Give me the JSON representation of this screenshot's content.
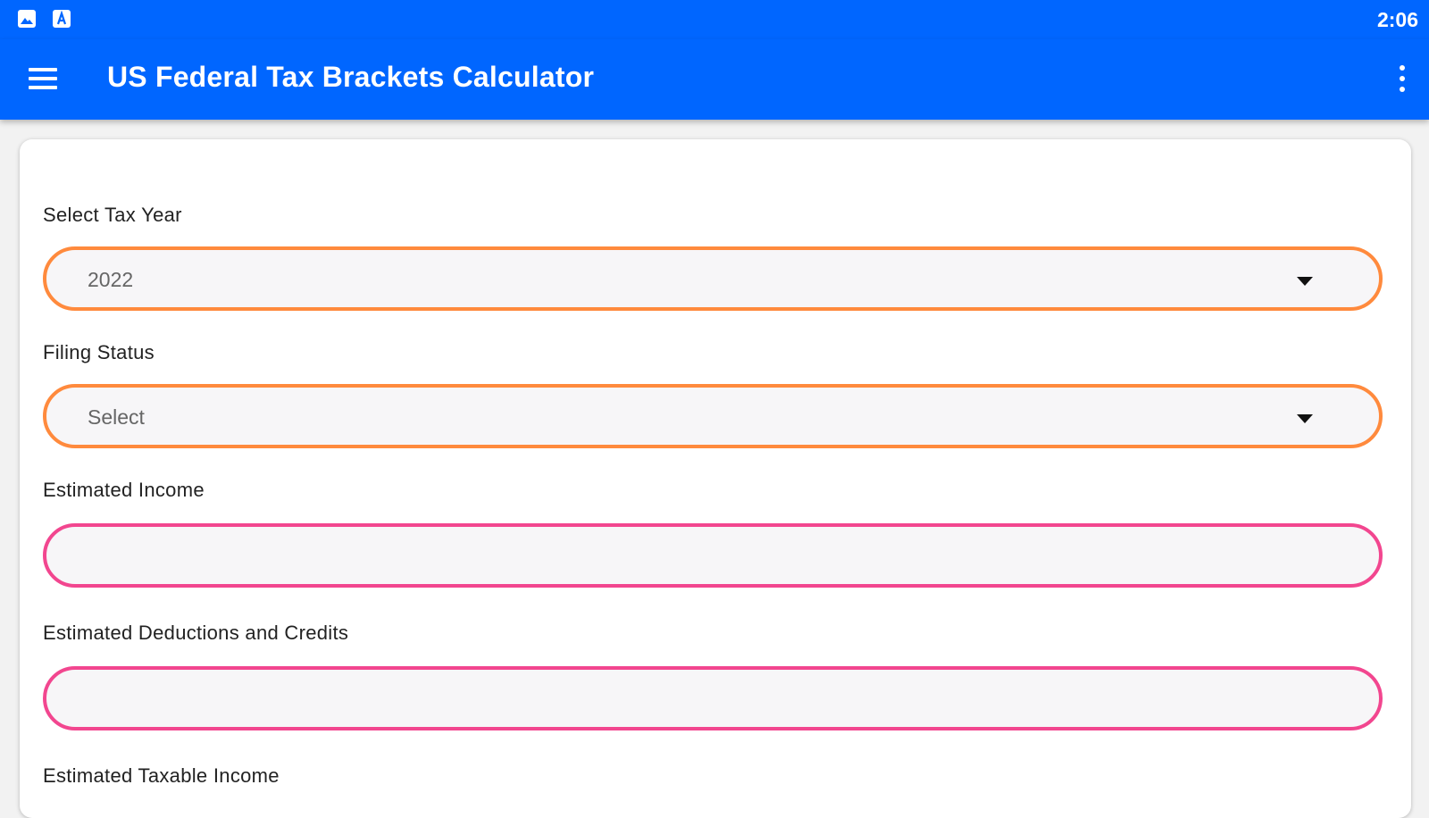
{
  "status_bar": {
    "time": "2:06",
    "icons": [
      "image-icon",
      "a-notification-icon"
    ]
  },
  "app_bar": {
    "title": "US Federal Tax Brackets Calculator",
    "menu_icon": "hamburger-menu-icon",
    "overflow_icon": "more-vert-icon"
  },
  "form": {
    "tax_year": {
      "label": "Select Tax Year",
      "value": "2022"
    },
    "filing_status": {
      "label": "Filing Status",
      "value": "Select"
    },
    "estimated_income": {
      "label": "Estimated Income",
      "value": ""
    },
    "estimated_deductions": {
      "label": "Estimated Deductions and Credits",
      "value": ""
    },
    "estimated_taxable_income": {
      "label": "Estimated Taxable Income"
    }
  },
  "colors": {
    "primary": "#0066ff",
    "select_border": "#ff8a3d",
    "input_border": "#f2468f",
    "card_background": "#ffffff"
  }
}
